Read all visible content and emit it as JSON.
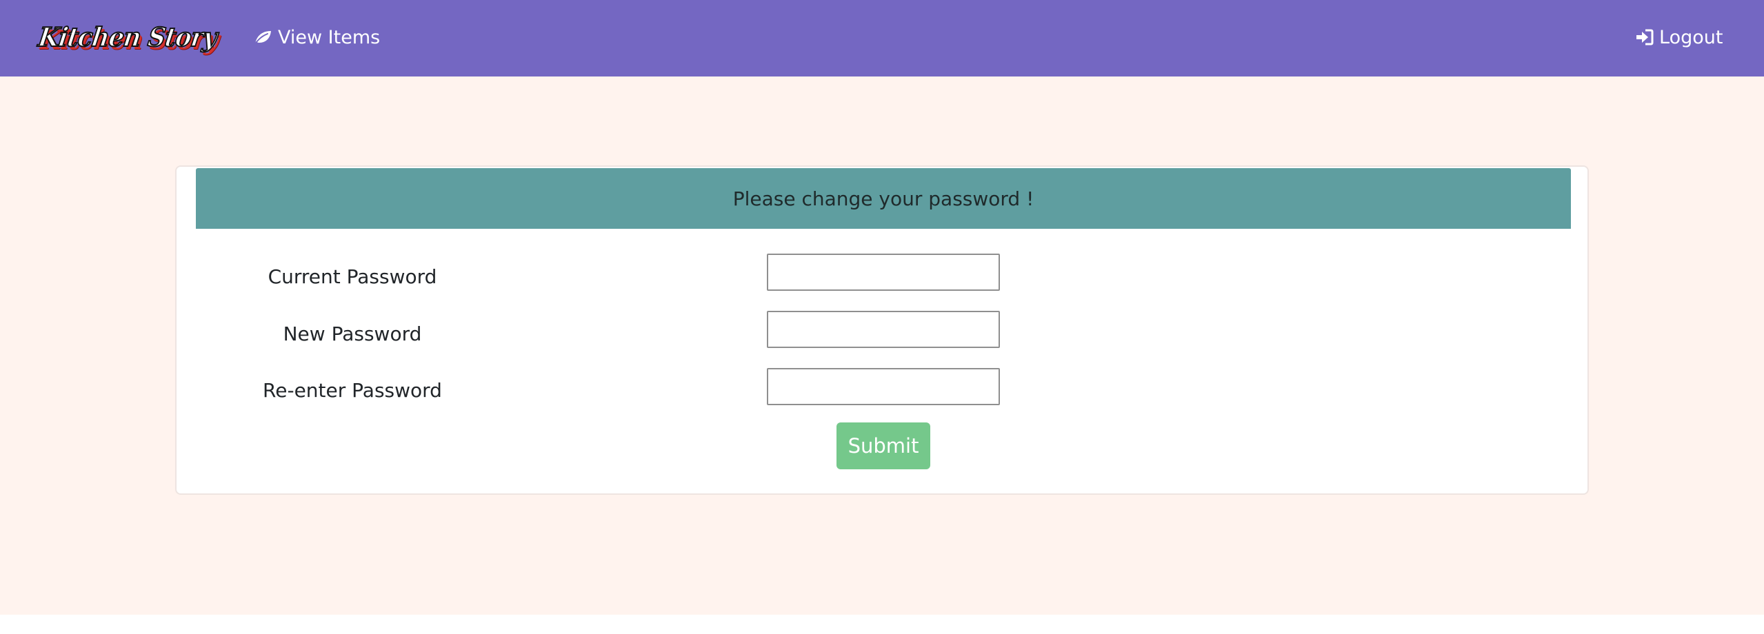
{
  "navbar": {
    "brand": "Kitchen Story",
    "view_items": "View Items",
    "logout": "Logout",
    "background": "#7467c2"
  },
  "card": {
    "header": "Please change your password !",
    "header_color": "#5f9ea0"
  },
  "form": {
    "current_password": {
      "label": "Current Password",
      "value": "",
      "placeholder": ""
    },
    "new_password": {
      "label": "New Password",
      "value": "",
      "placeholder": ""
    },
    "reenter_password": {
      "label": "Re-enter Password",
      "value": "",
      "placeholder": ""
    },
    "submit_label": "Submit",
    "submit_color": "#75c88b"
  },
  "page_background": "#fff3ee",
  "icons": {
    "view_items": "leaf-icon",
    "logout": "sign-in-icon"
  }
}
